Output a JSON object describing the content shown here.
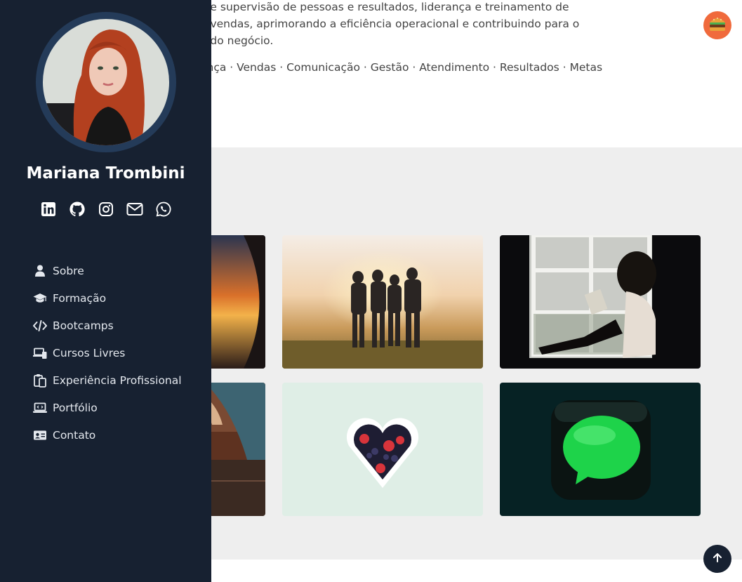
{
  "profile": {
    "name": "Mariana Trombini"
  },
  "about": {
    "description_lines": [
      "o e supervisão de pessoas e resultados, liderança e treinamento de",
      "e vendas, aprimorando a eficiência operacional e contribuindo para o",
      "o do negócio."
    ],
    "tags": "ança · Vendas · Comunicação · Gestão · Atendimento · Resultados · Metas"
  },
  "socials": [
    "linkedin-icon",
    "github-icon",
    "instagram-icon",
    "mail-icon",
    "whatsapp-icon"
  ],
  "nav": [
    {
      "label": "Sobre",
      "icon": "user-icon"
    },
    {
      "label": "Formação",
      "icon": "graduation-cap-icon"
    },
    {
      "label": "Bootcamps",
      "icon": "code-icon"
    },
    {
      "label": "Cursos Livres",
      "icon": "laptop-phone-icon"
    },
    {
      "label": "Experiência Profissional",
      "icon": "clipboard-icon"
    },
    {
      "label": "Portfólio",
      "icon": "laptop-code-icon"
    },
    {
      "label": "Contato",
      "icon": "id-card-icon"
    }
  ],
  "buttons": {
    "menu_icon": "burger-icon",
    "top_icon": "arrow-up-icon"
  },
  "colors": {
    "sidebar": "#172131",
    "avatar_ring": "#243b59",
    "gallery_bg": "#eeeeee",
    "menu_button": "#f06a3c"
  }
}
